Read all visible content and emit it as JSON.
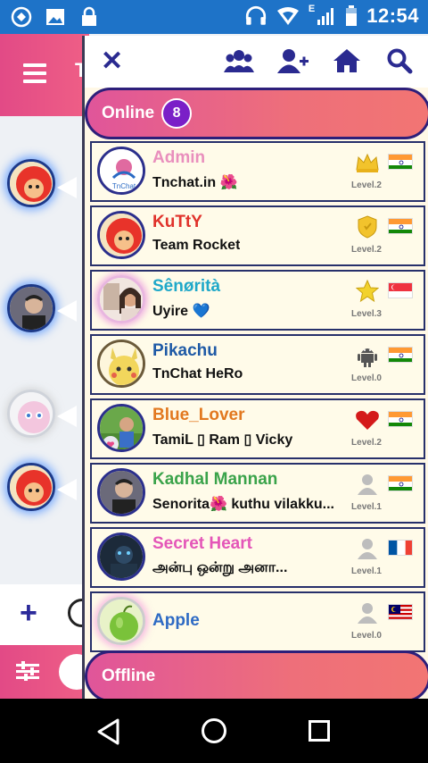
{
  "status_bar": {
    "time": "12:54",
    "network_label": "E",
    "left_icons": [
      "sync-icon",
      "image-icon",
      "lock-icon"
    ],
    "right_icons": [
      "headset-icon",
      "wifi-icon",
      "signal-icon",
      "battery-icon"
    ]
  },
  "app": {
    "header_partial_title": "T",
    "accent_color": "#e24a86"
  },
  "drawer": {
    "toolbar_icons": [
      "close-icon",
      "group-icon",
      "add-user-icon",
      "home-icon",
      "search-icon"
    ],
    "online_section": {
      "label": "Online",
      "count": "8"
    },
    "offline_section": {
      "label": "Offline"
    },
    "users": [
      {
        "name": "Admin",
        "status": "Tnchat.in 🌺",
        "level": "Level.2",
        "rank_icon": "crown-icon",
        "flag": "india",
        "name_color": "#e98fbd"
      },
      {
        "name": "KuTtY",
        "status": "Team Rocket",
        "level": "Level.2",
        "rank_icon": "shield-icon",
        "flag": "india",
        "name_color": "#e0322b"
      },
      {
        "name": "Sênørità",
        "status": "Uyire 💙",
        "level": "Level.3",
        "rank_icon": "star-icon",
        "flag": "singapore",
        "name_color": "#1fa8c9"
      },
      {
        "name": "Pikachu",
        "status": "TnChat HeRo",
        "level": "Level.0",
        "rank_icon": "android-icon",
        "flag": "india",
        "name_color": "#1f5aa6"
      },
      {
        "name": "Blue_Lover",
        "status": "TamiL ▯ Ram ▯ Vicky",
        "level": "Level.2",
        "rank_icon": "heart-icon",
        "flag": "india",
        "name_color": "#e2781f"
      },
      {
        "name": "Kadhal Mannan",
        "status": "Senorita🌺 kuthu vilakku...",
        "level": "Level.1",
        "rank_icon": "user-icon",
        "flag": "india",
        "name_color": "#3aa34a"
      },
      {
        "name": "Secret Heart",
        "status": "அன்பு ஒன்று அனா...",
        "level": "Level.1",
        "rank_icon": "user-icon",
        "flag": "france",
        "name_color": "#e456b8"
      },
      {
        "name": "Apple",
        "status": "",
        "level": "Level.0",
        "rank_icon": "user-icon",
        "flag": "malaysia",
        "name_color": "#2e6ac4"
      }
    ]
  },
  "nav_bar": {
    "icons": [
      "back-icon",
      "home-circle-icon",
      "recents-icon"
    ]
  }
}
